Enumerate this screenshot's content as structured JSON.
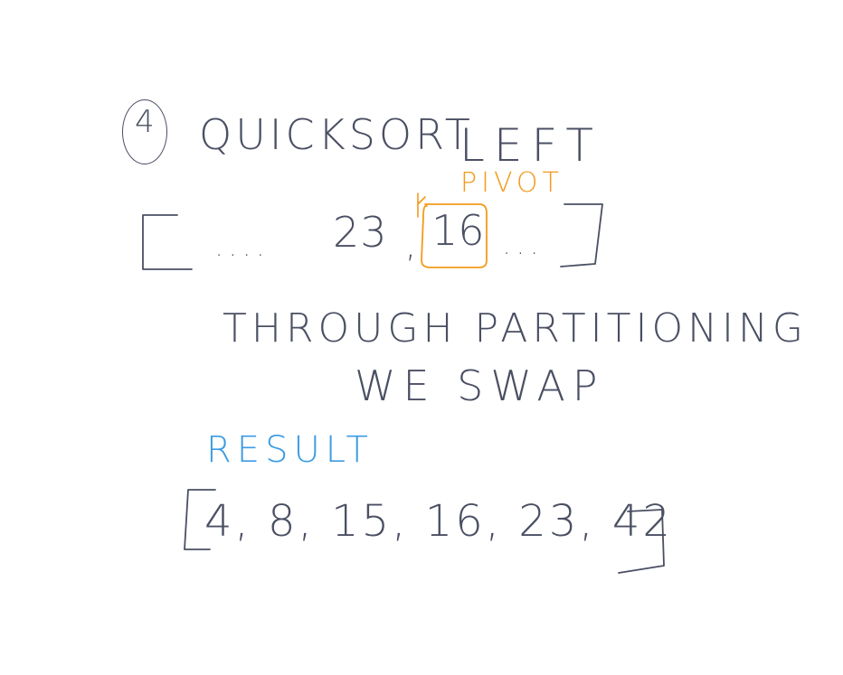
{
  "step": {
    "number": "4"
  },
  "title": {
    "algorithm": "QUICKSORT",
    "side": "LEFT"
  },
  "pivot": {
    "label": "PIVOT",
    "value": "16"
  },
  "array": {
    "left_ellipsis": "....",
    "visible_value": "23",
    "comma": ",",
    "right_ellipsis": "..."
  },
  "notes": {
    "line1": "THROUGH PARTITIONING",
    "line2": "WE SWAP"
  },
  "result": {
    "label": "RESULT",
    "values_text": "4, 8, 15, 16, 23, 42"
  },
  "colors": {
    "ink": "#4a4f63",
    "pivot": "#f39a1c",
    "result": "#3b9be4"
  }
}
